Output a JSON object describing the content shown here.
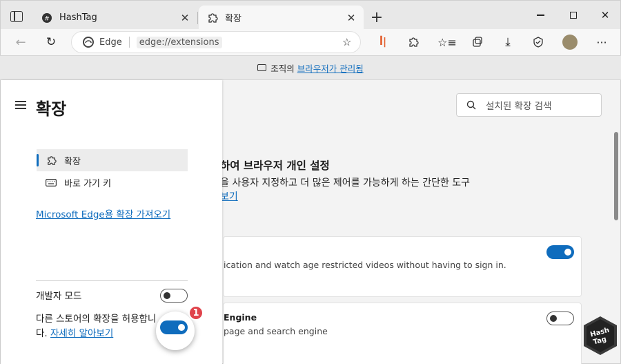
{
  "tabs": [
    {
      "title": "HashTag",
      "state": "inactive"
    },
    {
      "title": "확장",
      "state": "active"
    }
  ],
  "toolbar": {
    "edge_label": "Edge",
    "url": "edge://extensions"
  },
  "managed_bar": {
    "text": "조직의",
    "link": "브라우저가 관리됨"
  },
  "sidebar": {
    "title": "확장",
    "items": [
      {
        "label": "확장",
        "icon": "puzzle-icon",
        "selected": true
      },
      {
        "label": "바로 가기 키",
        "icon": "keyboard-icon",
        "selected": false
      }
    ],
    "get_extensions_link": "Microsoft Edge용 확장 가져오기",
    "developer_mode_label": "개발자 모드",
    "developer_mode_on": false,
    "other_stores_text": "다른 스토어의 확장을 허용합니다.",
    "other_stores_link": "자세히 알아보기",
    "other_stores_on": true,
    "badge": "1"
  },
  "search": {
    "placeholder": "설치된 확장 검색"
  },
  "main": {
    "heading": "하여 브라우저 개인 설정",
    "description": "을 사용자 지정하고 더 많은 제어를 가능하게 하는 간단한 도구",
    "link": "보기",
    "extensions": [
      {
        "name": "",
        "description": "ication and watch age restricted videos without having to sign in.",
        "enabled": true
      },
      {
        "name": "Engine",
        "description": "page and search engine",
        "enabled": false
      }
    ]
  },
  "colors": {
    "accent": "#0f6cbd",
    "badge": "#e0434b"
  }
}
